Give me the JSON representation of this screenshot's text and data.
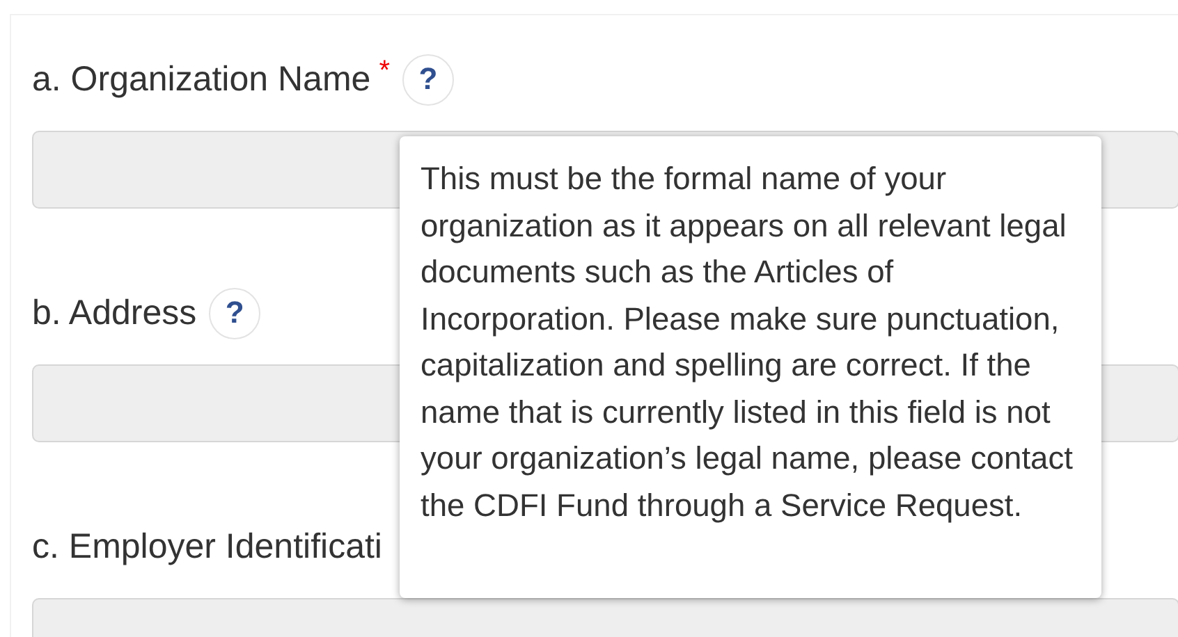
{
  "fields": [
    {
      "label": "a. Organization Name",
      "required_mark": "*",
      "help": "?",
      "disabled": true
    },
    {
      "label": "b. Address",
      "help": "?",
      "disabled": true
    },
    {
      "label": "c. Employer Identificati",
      "disabled": true
    }
  ],
  "tooltip": {
    "text": "This must be the formal name of your organization as it appears on all relevant legal documents such as the Articles of Incorporation. Please make sure punctuation, capitalization and spelling are correct. If the name that is currently listed in this field is not your organization’s legal name, please contact the CDFI Fund through a Service Request."
  }
}
